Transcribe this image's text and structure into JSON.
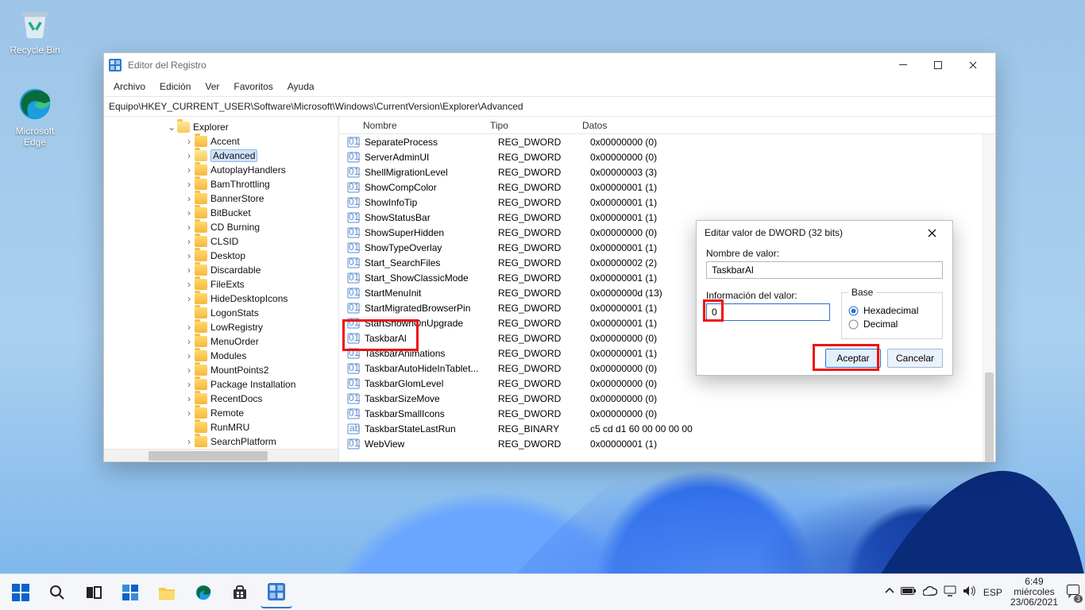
{
  "desktop": {
    "recycle": "Recycle Bin",
    "edge": "Microsoft Edge"
  },
  "window": {
    "title": "Editor del Registro",
    "menu": {
      "file": "Archivo",
      "edit": "Edición",
      "view": "Ver",
      "favorites": "Favoritos",
      "help": "Ayuda"
    },
    "address": "Equipo\\HKEY_CURRENT_USER\\Software\\Microsoft\\Windows\\CurrentVersion\\Explorer\\Advanced",
    "cols": {
      "name": "Nombre",
      "type": "Tipo",
      "data": "Datos"
    }
  },
  "tree": [
    {
      "label": "Explorer",
      "level": 0,
      "expanded": true,
      "open": true
    },
    {
      "label": "Accent"
    },
    {
      "label": "Advanced",
      "selected": true,
      "open": true
    },
    {
      "label": "AutoplayHandlers"
    },
    {
      "label": "BamThrottling"
    },
    {
      "label": "BannerStore"
    },
    {
      "label": "BitBucket"
    },
    {
      "label": "CD Burning"
    },
    {
      "label": "CLSID"
    },
    {
      "label": "Desktop"
    },
    {
      "label": "Discardable"
    },
    {
      "label": "FileExts"
    },
    {
      "label": "HideDesktopIcons"
    },
    {
      "label": "LogonStats",
      "noexp": true
    },
    {
      "label": "LowRegistry"
    },
    {
      "label": "MenuOrder"
    },
    {
      "label": "Modules"
    },
    {
      "label": "MountPoints2"
    },
    {
      "label": "Package Installation"
    },
    {
      "label": "RecentDocs"
    },
    {
      "label": "Remote"
    },
    {
      "label": "RunMRU",
      "noexp": true
    },
    {
      "label": "SearchPlatform"
    }
  ],
  "rows": [
    {
      "n": "SeparateProcess",
      "t": "REG_DWORD",
      "d": "0x00000000 (0)"
    },
    {
      "n": "ServerAdminUI",
      "t": "REG_DWORD",
      "d": "0x00000000 (0)"
    },
    {
      "n": "ShellMigrationLevel",
      "t": "REG_DWORD",
      "d": "0x00000003 (3)"
    },
    {
      "n": "ShowCompColor",
      "t": "REG_DWORD",
      "d": "0x00000001 (1)"
    },
    {
      "n": "ShowInfoTip",
      "t": "REG_DWORD",
      "d": "0x00000001 (1)"
    },
    {
      "n": "ShowStatusBar",
      "t": "REG_DWORD",
      "d": "0x00000001 (1)"
    },
    {
      "n": "ShowSuperHidden",
      "t": "REG_DWORD",
      "d": "0x00000000 (0)"
    },
    {
      "n": "ShowTypeOverlay",
      "t": "REG_DWORD",
      "d": "0x00000001 (1)"
    },
    {
      "n": "Start_SearchFiles",
      "t": "REG_DWORD",
      "d": "0x00000002 (2)"
    },
    {
      "n": "Start_ShowClassicMode",
      "t": "REG_DWORD",
      "d": "0x00000001 (1)"
    },
    {
      "n": "StartMenuInit",
      "t": "REG_DWORD",
      "d": "0x0000000d (13)"
    },
    {
      "n": "StartMigratedBrowserPin",
      "t": "REG_DWORD",
      "d": "0x00000001 (1)"
    },
    {
      "n": "StartShownOnUpgrade",
      "t": "REG_DWORD",
      "d": "0x00000001 (1)"
    },
    {
      "n": "TaskbarAl",
      "t": "REG_DWORD",
      "d": "0x00000000 (0)",
      "hi": true
    },
    {
      "n": "TaskbarAnimations",
      "t": "REG_DWORD",
      "d": "0x00000001 (1)"
    },
    {
      "n": "TaskbarAutoHideInTablet...",
      "t": "REG_DWORD",
      "d": "0x00000000 (0)"
    },
    {
      "n": "TaskbarGlomLevel",
      "t": "REG_DWORD",
      "d": "0x00000000 (0)"
    },
    {
      "n": "TaskbarSizeMove",
      "t": "REG_DWORD",
      "d": "0x00000000 (0)"
    },
    {
      "n": "TaskbarSmallIcons",
      "t": "REG_DWORD",
      "d": "0x00000000 (0)"
    },
    {
      "n": "TaskbarStateLastRun",
      "t": "REG_BINARY",
      "d": "c5 cd d1 60 00 00 00 00"
    },
    {
      "n": "WebView",
      "t": "REG_DWORD",
      "d": "0x00000001 (1)"
    }
  ],
  "dialog": {
    "title": "Editar valor de DWORD (32 bits)",
    "name_lbl": "Nombre de valor:",
    "name_val": "TaskbarAl",
    "info_lbl": "Información del valor:",
    "value": "0",
    "base_lbl": "Base",
    "hex": "Hexadecimal",
    "dec": "Decimal",
    "ok": "Aceptar",
    "cancel": "Cancelar"
  },
  "taskbar": {
    "lang": "ESP",
    "time": "6:49",
    "day": "miércoles",
    "date": "23/06/2021"
  }
}
